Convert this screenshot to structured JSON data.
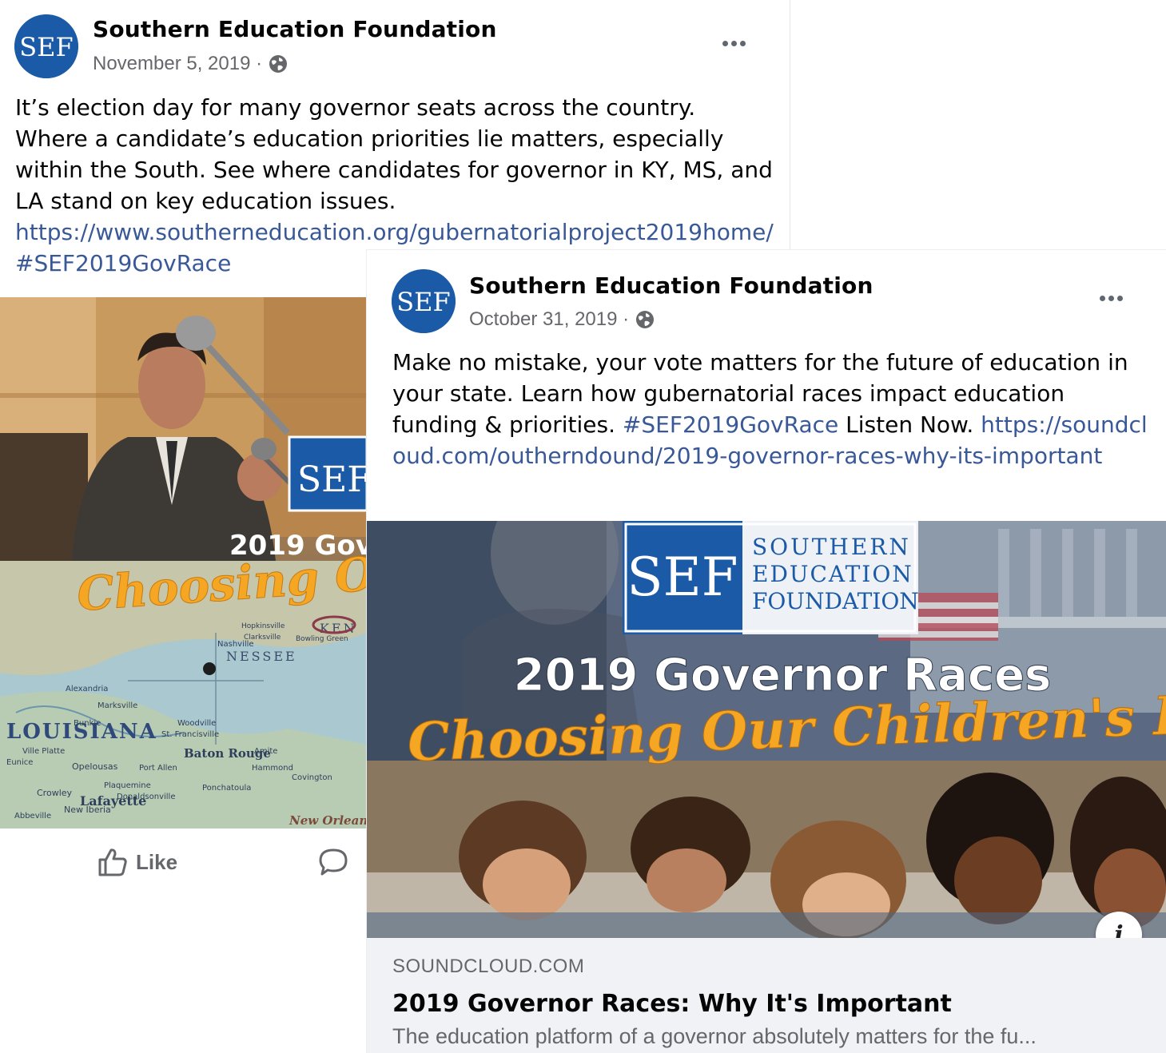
{
  "post1": {
    "author": "Southern Education Foundation",
    "avatar_text": "SEF",
    "date": "November 5, 2019 ·",
    "text": "It’s election day for many governor seats across the country. Where a candidate’s education priorities lie matters, especially within the South. See where candidates for governor in KY, MS, and LA stand on key education issues.",
    "link": "https://www.southerneducation.org/gubernatorialproject2019home/",
    "hashtag": "#SEF2019GovRace",
    "image": {
      "logo_text": "SEF",
      "headline": "2019 Gov",
      "script_text": "Choosing Our C",
      "map_labels": [
        "LOUISIANA",
        "Baton Rouge",
        "Lafayette",
        "New Orlean",
        "Alexandria",
        "Opelousas",
        "Hammond",
        "Covington",
        "Abbeville",
        "Crowley",
        "Eunice",
        "Ville Platte",
        "Bunkie",
        "Marksville",
        "Woodville",
        "Amite",
        "Ponchatoula",
        "Donaldsonville",
        "St. Francisville",
        "Port Allen",
        "Plaquemine",
        "New Iberia",
        "Hopkinsville",
        "Clarksville",
        "Bowling Green",
        "KEN",
        "NESSEE",
        "Nashville"
      ]
    },
    "actions": {
      "like": "Like"
    }
  },
  "post2": {
    "author": "Southern Education Foundation",
    "avatar_text": "SEF",
    "date": "October 31, 2019 ·",
    "text_before": "Make no mistake, your vote matters for the future of education in your state. Learn how gubernatorial races impact education funding & priorities.",
    "hashtag": "#SEF2019GovRace",
    "text_after": "Listen Now.",
    "link": "https://soundcloud.com/outherndound/2019-governor-races-why-its-important",
    "image": {
      "logo_mark": "SEF",
      "logo_line1": "SOUTHERN",
      "logo_line2": "EDUCATION",
      "logo_line3": "FOUNDATION",
      "headline": "2019 Governor Races",
      "script_text": "Choosing Our Children's Future"
    },
    "card": {
      "domain": "SOUNDCLOUD.COM",
      "title": "2019 Governor Races: Why It's Important",
      "description": "The education platform of a governor absolutely matters for the fu...",
      "info": "i"
    }
  },
  "colors": {
    "link": "#385898",
    "sef_blue": "#1b5aa6",
    "script_orange": "#f5a623",
    "secondary_text": "#65676b"
  }
}
